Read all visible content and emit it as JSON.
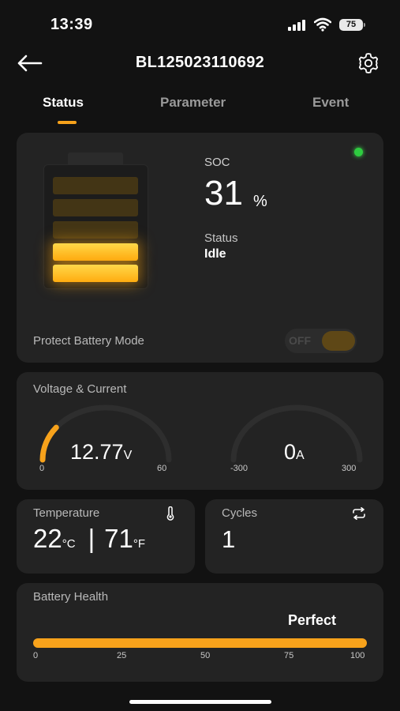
{
  "status_bar": {
    "time": "13:39",
    "battery_level": "75"
  },
  "header": {
    "title": "BL125023110692",
    "back_icon": "arrow-left-icon",
    "settings_icon": "gear-icon"
  },
  "tabs": [
    {
      "label": "Status",
      "active": true
    },
    {
      "label": "Parameter",
      "active": false
    },
    {
      "label": "Event",
      "active": false
    }
  ],
  "battery_card": {
    "soc_label": "SOC",
    "soc_value": "31",
    "soc_unit": "%",
    "status_label": "Status",
    "status_value": "Idle",
    "protect_label": "Protect Battery Mode",
    "protect_toggle_text": "OFF",
    "indicator_color": "#2ecc40",
    "levels_lit": 2,
    "levels_total": 5
  },
  "voltage_current": {
    "title": "Voltage & Current",
    "voltage": {
      "value": "12.77",
      "unit": "V",
      "min": "0",
      "max": "60",
      "fraction": 0.213
    },
    "current": {
      "value": "0",
      "unit": "A",
      "min": "-300",
      "max": "300",
      "fraction": 0.5
    }
  },
  "temperature": {
    "title": "Temperature",
    "celsius": "22",
    "celsius_unit": "°C",
    "separator": "|",
    "fahrenheit": "71",
    "fahrenheit_unit": "°F",
    "icon": "thermometer-icon"
  },
  "cycles": {
    "title": "Cycles",
    "value": "1",
    "icon": "cycle-arrows-icon"
  },
  "health": {
    "title": "Battery Health",
    "status": "Perfect",
    "ticks": [
      "0",
      "25",
      "50",
      "75",
      "100"
    ],
    "percent": 100
  },
  "colors": {
    "accent": "#f7a21b",
    "card": "#232323",
    "background": "#121212"
  }
}
